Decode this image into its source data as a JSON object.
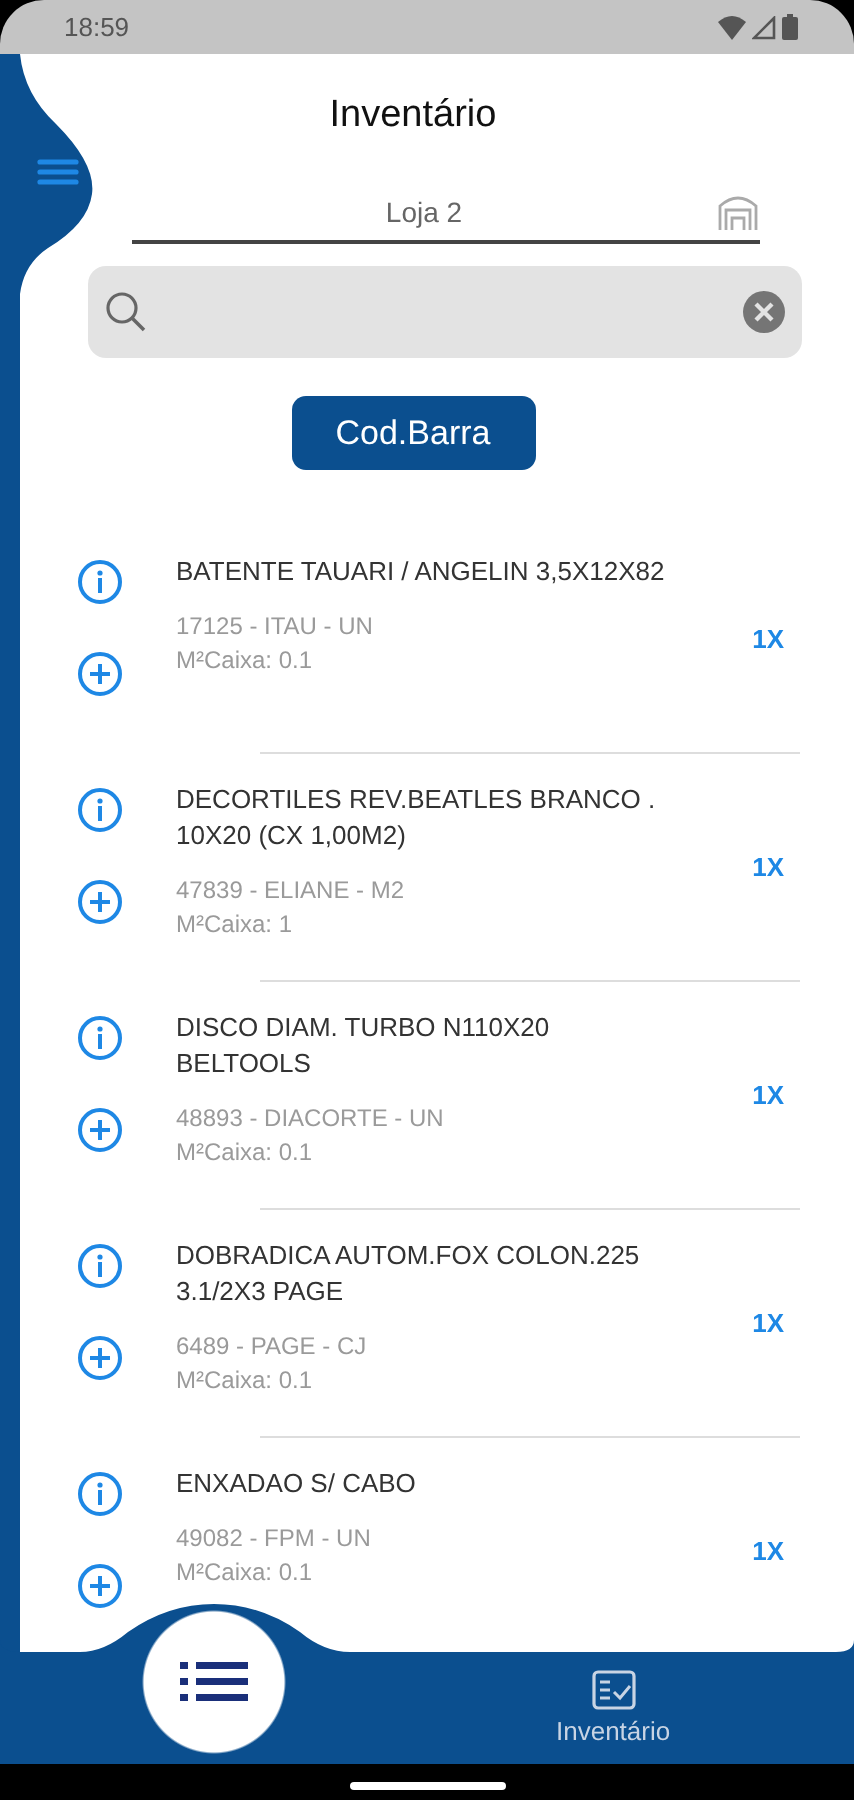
{
  "status_bar": {
    "time": "18:59"
  },
  "header": {
    "title": "Inventário"
  },
  "store_field": {
    "value": "Loja 2"
  },
  "barcode_button": {
    "label": "Cod.Barra"
  },
  "items": [
    {
      "name": "BATENTE TAUARI / ANGELIN 3,5X12X82",
      "detail": "17125 - ITAU - UN",
      "box": "M²Caixa: 0.1",
      "quantity": "1X"
    },
    {
      "name": "DECORTILES REV.BEATLES BRANCO . 10X20 (CX 1,00M2)",
      "detail": "47839 - ELIANE - M2",
      "box": "M²Caixa: 1",
      "quantity": "1X"
    },
    {
      "name": "DISCO DIAM. TURBO N110X20 BELTOOLS",
      "detail": "48893 - DIACORTE - UN",
      "box": "M²Caixa: 0.1",
      "quantity": "1X"
    },
    {
      "name": "DOBRADICA AUTOM.FOX COLON.225 3.1/2X3 PAGE",
      "detail": "6489 - PAGE - CJ",
      "box": "M²Caixa: 0.1",
      "quantity": "1X"
    },
    {
      "name": "ENXADAO S/ CABO",
      "detail": "49082 - FPM - UN",
      "box": "M²Caixa: 0.1",
      "quantity": "1X"
    }
  ],
  "bottom_nav": [
    {
      "kind": "fab"
    },
    {
      "kind": "tab",
      "label": "Inventário"
    }
  ]
}
